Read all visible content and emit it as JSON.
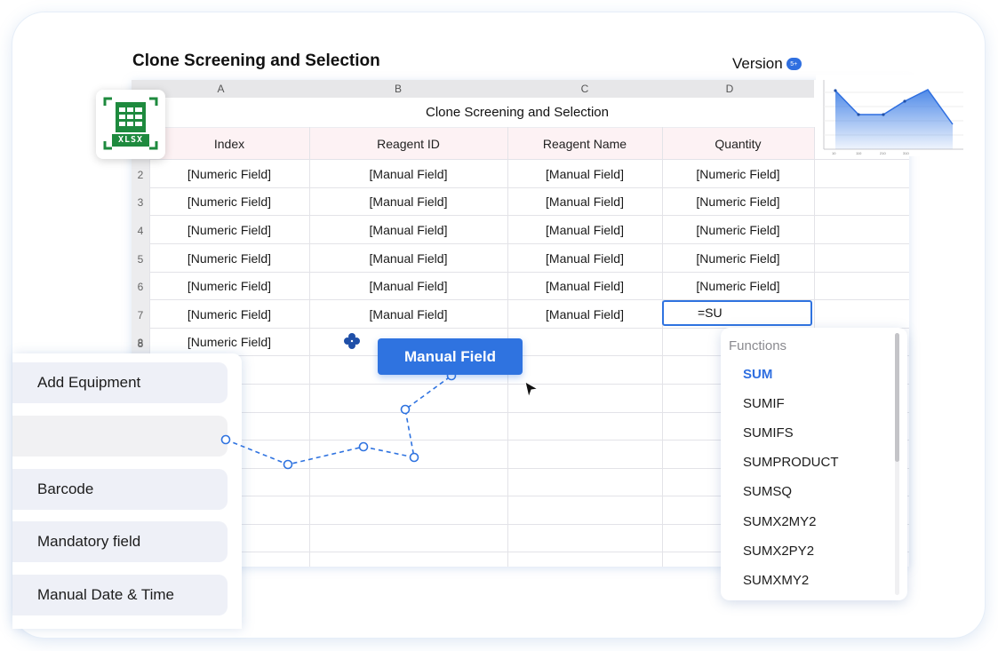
{
  "page_title": "Clone Screening and Selection",
  "version": {
    "label": "Version",
    "badge": "5+"
  },
  "sheet": {
    "columns": [
      "A",
      "B",
      "C",
      "D"
    ],
    "title": "Clone Screening and Selection",
    "headers": [
      "Index",
      "Reagent ID",
      "Reagent Name",
      "Quantity"
    ],
    "rows": [
      {
        "num": "2",
        "cells": [
          "[Numeric Field]",
          "[Manual Field]",
          "[Manual Field]",
          "[Numeric Field]"
        ]
      },
      {
        "num": "3",
        "cells": [
          "[Numeric Field]",
          "[Manual Field]",
          "[Manual Field]",
          "[Numeric Field]"
        ]
      },
      {
        "num": "4",
        "cells": [
          "[Numeric Field]",
          "[Manual Field]",
          "[Manual Field]",
          "[Numeric Field]"
        ]
      },
      {
        "num": "5",
        "cells": [
          "[Numeric Field]",
          "[Manual Field]",
          "[Manual Field]",
          "[Numeric Field]"
        ]
      },
      {
        "num": "6",
        "cells": [
          "[Numeric Field]",
          "[Manual Field]",
          "[Manual Field]",
          "[Numeric Field]"
        ]
      },
      {
        "num": "7",
        "cells": [
          "[Numeric Field]",
          "[Manual Field]",
          "[Manual Field]",
          ""
        ]
      },
      {
        "num": "8",
        "cells": [
          "[Numeric Field]",
          "",
          "",
          ""
        ]
      }
    ],
    "formula_value": "=SU"
  },
  "xlsx_icon": {
    "label": "XLSX",
    "icon": "xlsx-file-icon",
    "color": "#1e8a3e"
  },
  "drag_chip": {
    "label": "Manual Field"
  },
  "left_panel": {
    "items": [
      "Add Equipment",
      "",
      "Barcode",
      "Mandatory field",
      "Manual Date & Time"
    ]
  },
  "functions": {
    "title": "Functions",
    "items": [
      "SUM",
      "SUMIF",
      "SUMIFS",
      "SUMPRODUCT",
      "SUMSQ",
      "SUMX2MY2",
      "SUMX2PY2",
      "SUMXMY2"
    ],
    "active": "SUM"
  },
  "mini_chart_ticks": [
    "10",
    "110",
    "210",
    "310"
  ],
  "colors": {
    "accent": "#2f73e0",
    "header_fill": "#fdf2f4",
    "excel_green": "#1e8a3e"
  }
}
